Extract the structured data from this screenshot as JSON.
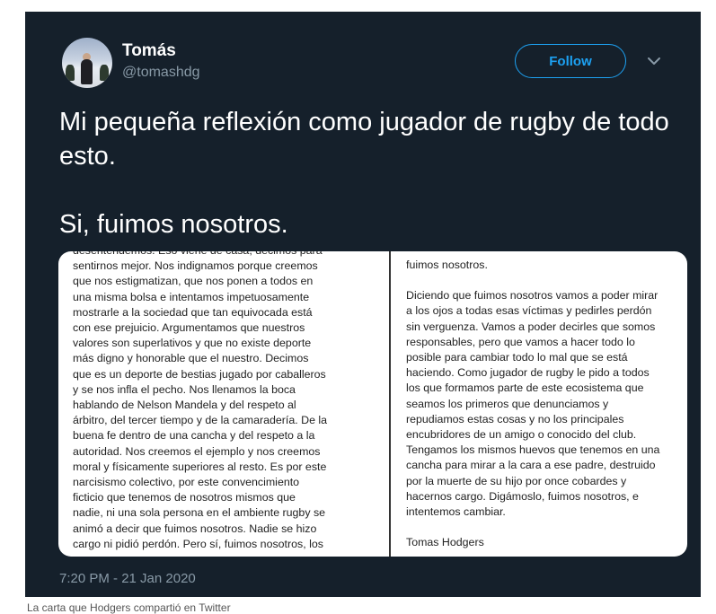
{
  "tweet": {
    "author_name": "Tomás",
    "author_handle": "@tomashdg",
    "follow_label": "Follow",
    "text_line1": "Mi pequeña reflexión como jugador de rugby de todo esto.",
    "text_line2": "Si, fuimos nosotros.",
    "timestamp": "7:20 PM - 21 Jan 2020"
  },
  "letter": {
    "left_column": [
      "desentendemos. Eso viene de casa, decimos para",
      "sentirnos mejor. Nos indignamos porque creemos",
      "que nos estigmatizan, que nos ponen a todos en",
      "una misma bolsa e intentamos impetuosamente",
      "mostrarle a la sociedad que tan equivocada está",
      "con ese prejuicio. Argumentamos que nuestros",
      "valores son superlativos y que no existe deporte",
      "más digno y honorable que el nuestro. Decimos",
      "que es un deporte de bestias jugado por caballeros",
      "y se nos infla el pecho. Nos llenamos la boca",
      "hablando de Nelson Mandela y del respeto al",
      "árbitro, del tercer tiempo y de la camaradería. De la",
      "buena fe dentro de una cancha y del respeto a la",
      "autoridad. Nos creemos el ejemplo y nos creemos",
      "moral y físicamente superiores al resto. Es por este",
      "narcisismo colectivo, por este convencimiento",
      "ficticio que tenemos de nosotros mismos que",
      "nadie, ni una sola persona en el ambiente rugby se",
      "animó a decir que fuimos nosotros. Nadie se hizo",
      "cargo ni pidió perdón. Pero sí, fuimos nosotros, los"
    ],
    "right_top": "fuimos nosotros.",
    "right_column": [
      "Diciendo que fuimos nosotros vamos a poder mirar",
      "a los ojos a todas esas víctimas y pedirles perdón",
      "sin verguenza. Vamos a poder decirles que somos",
      "responsables, pero que vamos a hacer todo lo",
      "posible para cambiar todo lo mal que se está",
      "haciendo. Como jugador de rugby le pido a todos",
      "los que formamos parte de este ecosistema que",
      "seamos los primeros que denunciamos y",
      "repudiamos estas cosas y no los principales",
      "encubridores de un amigo o conocido del club.",
      "Tengamos los mismos huevos que tenemos en una",
      "cancha para mirar a la cara a ese padre, destruido",
      "por la muerte de su hijo por once cobardes y",
      "hacernos cargo. Digámoslo, fuimos nosotros, e",
      "intentemos cambiar."
    ],
    "signature": "Tomas Hodgers"
  },
  "caption": "La carta que Hodgers compartió en Twitter",
  "colors": {
    "card_bg": "#15202b",
    "accent": "#1da1f2",
    "muted": "#8899a6"
  },
  "icons": [
    "avatar",
    "chevron-down-icon"
  ]
}
